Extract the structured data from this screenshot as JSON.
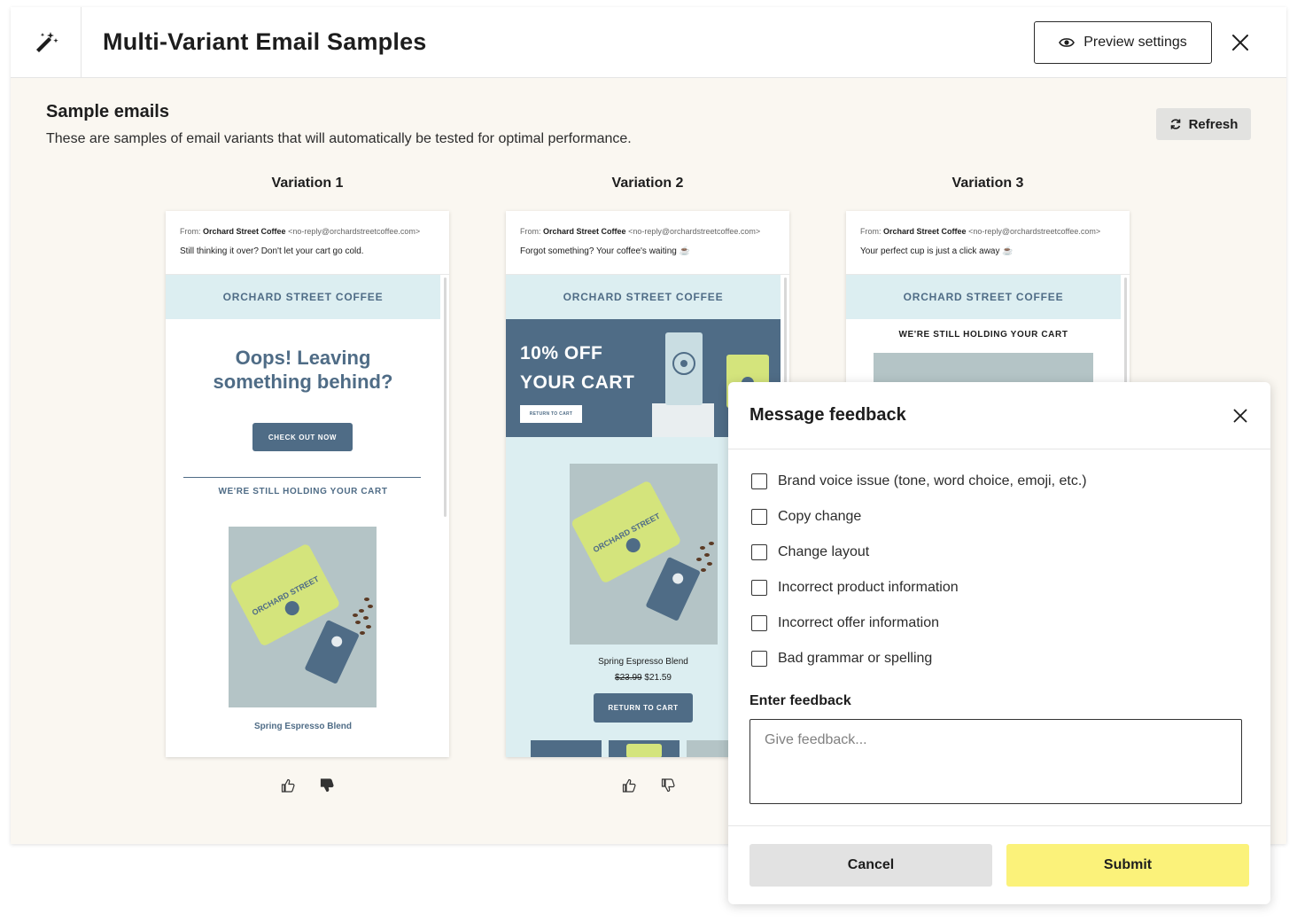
{
  "header": {
    "title": "Multi-Variant Email Samples",
    "preview_label": "Preview settings"
  },
  "section": {
    "title": "Sample emails",
    "description": "These are samples of email variants that will automatically be tested for optimal performance.",
    "refresh_label": "Refresh"
  },
  "email_from": {
    "prefix": "From:",
    "sender": "Orchard Street Coffee",
    "address": "<no-reply@orchardstreetcoffee.com>"
  },
  "brand": "ORCHARD STREET COFFEE",
  "variations": [
    {
      "label": "Variation 1",
      "subject": "Still thinking it over? Don't let your cart go cold.",
      "hero": "Oops! Leaving something behind?",
      "cta": "CHECK OUT NOW",
      "holding": "WE'RE STILL HOLDING YOUR CART",
      "product_name": "Spring Espresso Blend"
    },
    {
      "label": "Variation 2",
      "subject": "Forgot something? Your coffee's waiting ☕",
      "promo_line1": "10% OFF",
      "promo_line2": "YOUR CART",
      "promo_cta": "RETURN TO CART",
      "product_name": "Spring Espresso Blend",
      "old_price": "$23.99",
      "new_price": "$21.59",
      "cta": "RETURN TO CART"
    },
    {
      "label": "Variation 3",
      "subject": "Your perfect cup is just a click away ☕",
      "holding": "WE'RE STILL HOLDING YOUR CART"
    }
  ],
  "modal": {
    "title": "Message feedback",
    "options": [
      "Brand voice issue (tone, word choice, emoji, etc.)",
      "Copy change",
      "Change layout",
      "Incorrect product information",
      "Incorrect offer information",
      "Bad grammar or spelling"
    ],
    "feedback_label": "Enter feedback",
    "feedback_placeholder": "Give feedback...",
    "cancel_label": "Cancel",
    "submit_label": "Submit"
  },
  "colors": {
    "brand_blue": "#4f6c86",
    "light_blue": "#dceef1",
    "page_bg": "#faf7f1",
    "submit_yellow": "#fbf27a",
    "bag_green": "#d4e47c"
  }
}
